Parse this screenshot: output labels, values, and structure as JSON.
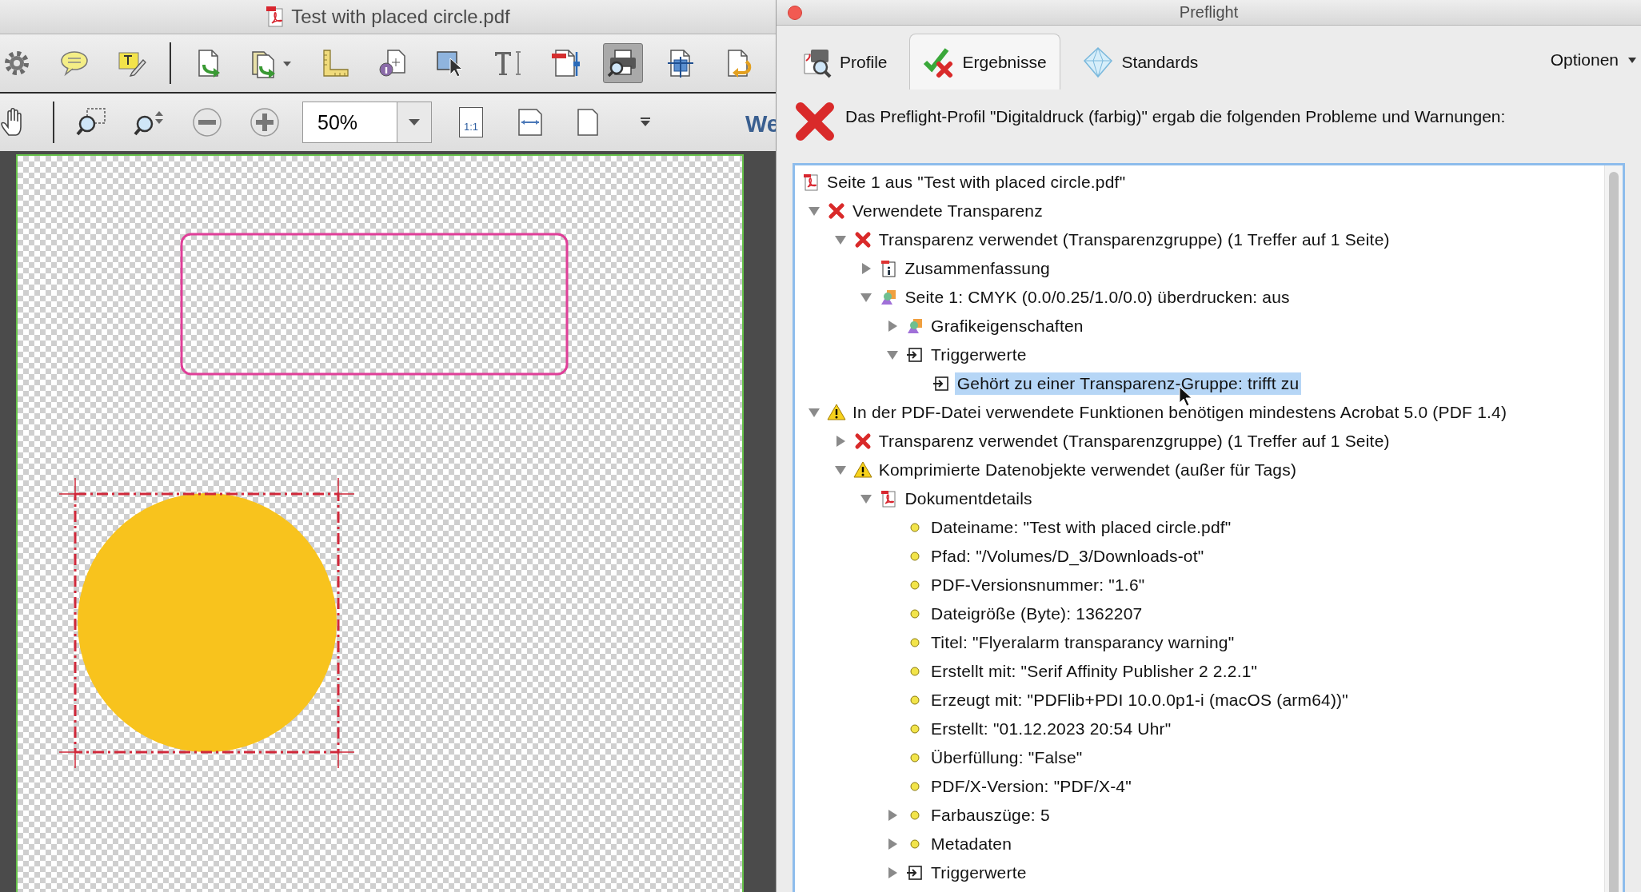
{
  "document_window": {
    "title": "Test with placed circle.pdf",
    "toolbar": [
      {
        "pressed": false
      },
      {
        "pressed": false
      },
      {
        "pressed": false
      },
      {
        "pressed": false
      },
      {
        "pressed": false
      },
      {
        "pressed": false
      },
      {
        "pressed": false
      },
      {
        "pressed": false
      },
      {
        "pressed": false
      },
      {
        "pressed": false
      },
      {
        "pressed": true
      },
      {
        "pressed": false
      },
      {
        "pressed": false
      }
    ],
    "zoom_field": {
      "value": "50%"
    },
    "actual_size_button": {
      "label": "1:1"
    },
    "toolbar_overflow_text": "We"
  },
  "preflight_window": {
    "title": "Preflight",
    "tabs": [
      {
        "label": "Profile",
        "selected": false
      },
      {
        "label": "Ergebnisse",
        "selected": true
      },
      {
        "label": "Standards",
        "selected": false
      }
    ],
    "options_menu": "Optionen",
    "message": "Das Preflight-Profil \"Digitaldruck (farbig)\" ergab die folgenden Probleme und Warnungen:",
    "tree": [
      {
        "text": "Seite 1 aus \"Test with placed circle.pdf\"",
        "kind": "pdf",
        "selected": false,
        "children": [
          {
            "text": "Verwendete Transparenz",
            "kind": "error",
            "expanded": true,
            "selected": false,
            "children": [
              {
                "text": "Transparenz verwendet (Transparenzgruppe) (1 Treffer auf 1 Seite)",
                "kind": "error",
                "expanded": true,
                "selected": false,
                "children": [
                  {
                    "text": "Zusammenfassung",
                    "kind": "summary",
                    "expanded": false,
                    "selected": false
                  },
                  {
                    "text": "Seite 1: CMYK (0.0/0.25/1.0/0.0) überdrucken: aus",
                    "kind": "graphic",
                    "expanded": true,
                    "selected": false,
                    "children": [
                      {
                        "text": "Grafikeigenschaften",
                        "kind": "graphic",
                        "expanded": false,
                        "selected": false
                      },
                      {
                        "text": "Triggerwerte",
                        "kind": "trigger",
                        "expanded": true,
                        "selected": false,
                        "children": [
                          {
                            "text": "Gehört zu einer Transparenz-Gruppe: trifft zu",
                            "kind": "trigger",
                            "selected": true
                          }
                        ]
                      }
                    ]
                  }
                ]
              }
            ]
          },
          {
            "text": "In der PDF-Datei verwendete Funktionen benötigen mindestens Acrobat 5.0 (PDF 1.4)",
            "kind": "warning",
            "expanded": true,
            "selected": false,
            "children": [
              {
                "text": "Transparenz verwendet (Transparenzgruppe) (1 Treffer auf 1 Seite)",
                "kind": "error",
                "expanded": false,
                "selected": false
              },
              {
                "text": "Komprimierte Datenobjekte verwendet (außer für Tags)",
                "kind": "warning",
                "expanded": true,
                "selected": false,
                "children": [
                  {
                    "text": "Dokumentdetails",
                    "kind": "pdf",
                    "expanded": true,
                    "selected": false,
                    "children": [
                      {
                        "text": "Dateiname: \"Test with placed circle.pdf\"",
                        "kind": "dot",
                        "selected": false
                      },
                      {
                        "text": "Pfad: \"/Volumes/D_3/Downloads-ot\"",
                        "kind": "dot",
                        "selected": false
                      },
                      {
                        "text": "PDF-Versionsnummer: \"1.6\"",
                        "kind": "dot",
                        "selected": false
                      },
                      {
                        "text": "Dateigröße (Byte): 1362207",
                        "kind": "dot",
                        "selected": false
                      },
                      {
                        "text": "Titel: \"Flyeralarm transparancy warning\"",
                        "kind": "dot",
                        "selected": false
                      },
                      {
                        "text": "Erstellt mit: \"Serif Affinity Publisher 2 2.2.1\"",
                        "kind": "dot",
                        "selected": false
                      },
                      {
                        "text": "Erzeugt mit: \"PDFlib+PDI 10.0.0p1-i (macOS (arm64))\"",
                        "kind": "dot",
                        "selected": false
                      },
                      {
                        "text": "Erstellt: \"01.12.2023 20:54 Uhr\"",
                        "kind": "dot",
                        "selected": false
                      },
                      {
                        "text": "Überfüllung: \"False\"",
                        "kind": "dot",
                        "selected": false
                      },
                      {
                        "text": "PDF/X-Version: \"PDF/X-4\"",
                        "kind": "dot",
                        "selected": false
                      },
                      {
                        "text": "Farbauszüge: 5",
                        "kind": "dot",
                        "expanded": false,
                        "selected": false
                      },
                      {
                        "text": "Metadaten",
                        "kind": "dot",
                        "expanded": false,
                        "selected": false
                      },
                      {
                        "text": "Triggerwerte",
                        "kind": "trigger",
                        "expanded": false,
                        "selected": false
                      }
                    ]
                  }
                ]
              }
            ]
          }
        ]
      }
    ]
  }
}
